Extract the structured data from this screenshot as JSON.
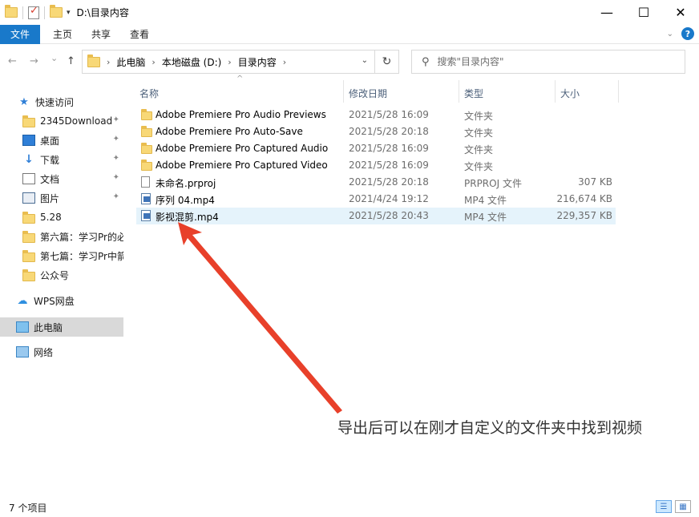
{
  "window": {
    "title": "D:\\目录内容",
    "buttons": {
      "minimize": "—",
      "maximize": "☐",
      "close": "✕"
    }
  },
  "ribbon": {
    "tabs": [
      "文件",
      "主页",
      "共享",
      "查看"
    ],
    "help": "?",
    "accent_color": "#1979ca"
  },
  "navigation": {
    "back": "←",
    "forward": "→",
    "recent": "⌄",
    "up": "↑",
    "breadcrumbs": [
      "此电脑",
      "本地磁盘 (D:)",
      "目录内容"
    ],
    "refresh": "↻",
    "search_placeholder": "搜索\"目录内容\""
  },
  "sidebar": {
    "items": [
      {
        "label": "快速访问",
        "icon": "star-icon",
        "pinned": false
      },
      {
        "label": "2345Download",
        "icon": "folder-icon",
        "pinned": true
      },
      {
        "label": "桌面",
        "icon": "desktop-icon",
        "pinned": true
      },
      {
        "label": "下载",
        "icon": "download-icon",
        "pinned": true
      },
      {
        "label": "文档",
        "icon": "document-icon",
        "pinned": true
      },
      {
        "label": "图片",
        "icon": "picture-icon",
        "pinned": true
      },
      {
        "label": "5.28",
        "icon": "folder-icon",
        "pinned": false
      },
      {
        "label": "第六篇：学习Pr的必",
        "icon": "folder-icon",
        "pinned": false
      },
      {
        "label": "第七篇：学习Pr中箭",
        "icon": "folder-icon",
        "pinned": false
      },
      {
        "label": "公众号",
        "icon": "folder-icon",
        "pinned": false
      },
      {
        "label": "WPS网盘",
        "icon": "cloud-icon",
        "pinned": false
      },
      {
        "label": "此电脑",
        "icon": "this-pc-icon",
        "pinned": false,
        "selected": true
      },
      {
        "label": "网络",
        "icon": "network-icon",
        "pinned": false
      }
    ]
  },
  "file_list": {
    "columns": [
      "名称",
      "修改日期",
      "类型",
      "大小"
    ],
    "rows": [
      {
        "name": "Adobe Premiere Pro Audio Previews",
        "date": "2021/5/28 16:09",
        "type": "文件夹",
        "size": "",
        "icon": "folder-icon"
      },
      {
        "name": "Adobe Premiere Pro Auto-Save",
        "date": "2021/5/28 20:18",
        "type": "文件夹",
        "size": "",
        "icon": "folder-icon"
      },
      {
        "name": "Adobe Premiere Pro Captured Audio",
        "date": "2021/5/28 16:09",
        "type": "文件夹",
        "size": "",
        "icon": "folder-icon"
      },
      {
        "name": "Adobe Premiere Pro Captured Video",
        "date": "2021/5/28 16:09",
        "type": "文件夹",
        "size": "",
        "icon": "folder-icon"
      },
      {
        "name": "未命名.prproj",
        "date": "2021/5/28 20:18",
        "type": "PRPROJ 文件",
        "size": "307 KB",
        "icon": "file-icon"
      },
      {
        "name": "序列 04.mp4",
        "date": "2021/4/24 19:12",
        "type": "MP4 文件",
        "size": "216,674 KB",
        "icon": "video-file-icon"
      },
      {
        "name": "影视混剪.mp4",
        "date": "2021/5/28 20:43",
        "type": "MP4 文件",
        "size": "229,357 KB",
        "icon": "video-file-icon",
        "selected": true
      }
    ]
  },
  "annotation": {
    "text": "导出后可以在刚才自定义的文件夹中找到视频",
    "arrow_color": "#e8402a"
  },
  "status_bar": {
    "item_count": "7 个项目"
  }
}
